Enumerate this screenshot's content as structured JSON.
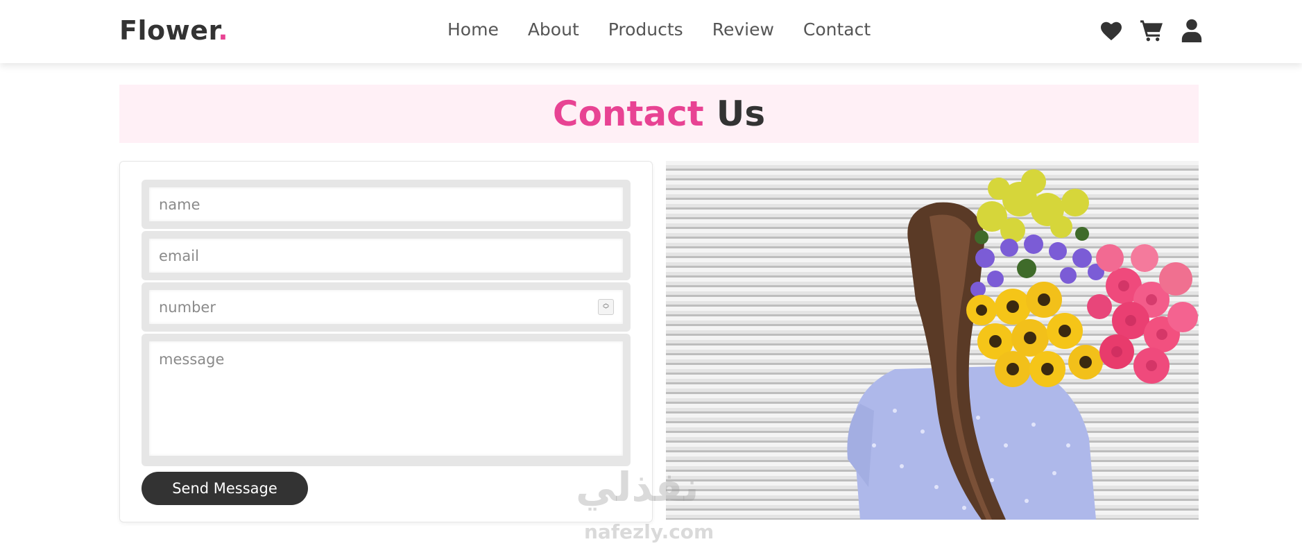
{
  "brand": {
    "name": "Flower",
    "dot": "."
  },
  "nav": {
    "items": [
      "Home",
      "About",
      "Products",
      "Review",
      "Contact"
    ]
  },
  "header_icons": [
    "heart-icon",
    "cart-icon",
    "user-icon"
  ],
  "heading": {
    "accent": "Contact",
    "rest": "Us"
  },
  "form": {
    "name_placeholder": "name",
    "email_placeholder": "email",
    "number_placeholder": "number",
    "message_placeholder": "message",
    "submit_label": "Send Message"
  },
  "watermark": {
    "arabic": "نفذلي",
    "latin": "nafezly.com"
  },
  "colors": {
    "accent": "#e84393",
    "dark": "#333333",
    "heading_bg": "#fff0f6"
  }
}
